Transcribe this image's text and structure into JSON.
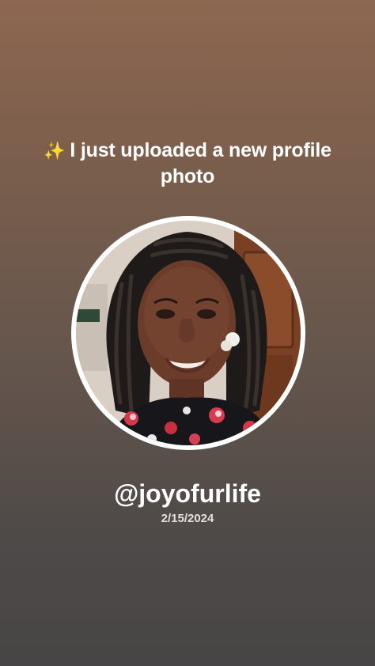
{
  "announcement": {
    "sparkle": "✨",
    "text": "I just uploaded a new profile photo"
  },
  "profile": {
    "photo_icon": "profile-photo",
    "handle": "@joyofurlife",
    "date": "2/15/2024"
  },
  "colors": {
    "gradient_top": "#8d6750",
    "gradient_bottom": "#474545",
    "ring": "#ffffff",
    "text": "#ffffff"
  }
}
